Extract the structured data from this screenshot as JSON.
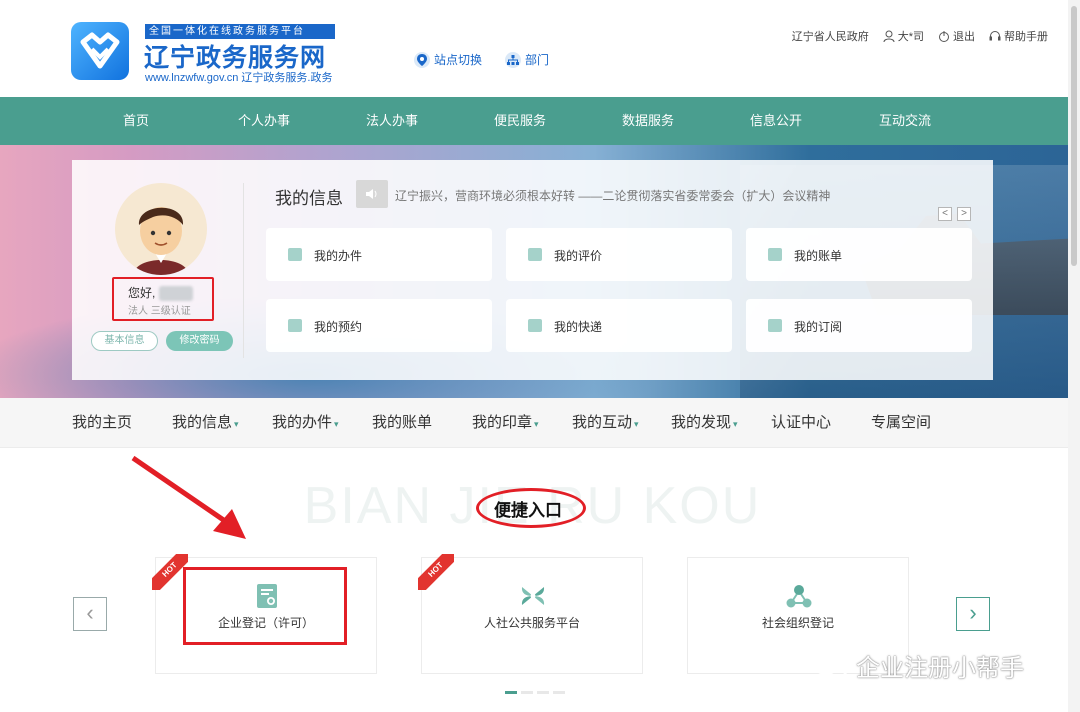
{
  "header": {
    "banner_text": "全国一体化在线政务服务平台",
    "site_title": "辽宁政务服务网",
    "site_subtitle": "www.lnzwfw.gov.cn  辽宁政务服务.政务",
    "station_switch": "站点切换",
    "department": "部门",
    "gov_link": "辽宁省人民政府",
    "user": "大*司",
    "logout": "退出",
    "help": "帮助手册"
  },
  "nav": {
    "items": [
      "首页",
      "个人办事",
      "法人办事",
      "便民服务",
      "数据服务",
      "信息公开",
      "互动交流"
    ]
  },
  "profile": {
    "greeting": "您好,",
    "auth": "法人  三级认证",
    "basic_info_btn": "基本信息",
    "change_pwd_btn": "修改密码"
  },
  "my_info": {
    "title": "我的信息",
    "notice": "辽宁振兴，营商环境必须根本好转 ——二论贯彻落实省委常委会（扩大）会议精神",
    "prev": "<",
    "next": ">",
    "tiles": [
      "我的办件",
      "我的评价",
      "我的账单",
      "我的预约",
      "我的快递",
      "我的订阅"
    ]
  },
  "subnav": {
    "items": [
      {
        "label": "我的主页",
        "caret": ""
      },
      {
        "label": "我的信息",
        "caret": "▾"
      },
      {
        "label": "我的办件",
        "caret": "▾"
      },
      {
        "label": "我的账单",
        "caret": ""
      },
      {
        "label": "我的印章",
        "caret": "▾"
      },
      {
        "label": "我的互动",
        "caret": "▾"
      },
      {
        "label": "我的发现",
        "caret": "▾"
      },
      {
        "label": "认证中心",
        "caret": ""
      },
      {
        "label": "专属空间",
        "caret": ""
      }
    ]
  },
  "quick": {
    "bg_text": "BIAN JIE RU KOU",
    "title": "便捷入口",
    "hot_label": "HOT",
    "cards": [
      "企业登记（许可）",
      "人社公共服务平台",
      "社会组织登记"
    ],
    "prev": "‹",
    "next": "›"
  },
  "watermark": "企业注册小帮手",
  "colors": {
    "primary": "#4a9e8f",
    "brand_blue": "#1a67c9",
    "highlight_red": "#e21f26"
  }
}
